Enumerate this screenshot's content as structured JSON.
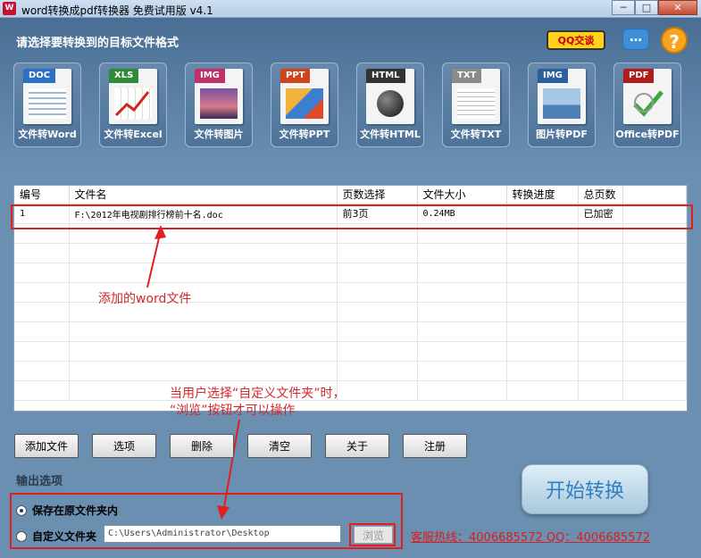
{
  "window": {
    "title": "word转换成pdf转换器 免费试用版 v4.1",
    "controls": [
      "─",
      "□",
      "✕"
    ]
  },
  "header": {
    "prompt": "请选择要转换到的目标文件格式",
    "qq_label": "QQ交谈",
    "chat_glyph": "…",
    "help_glyph": "?"
  },
  "tools": [
    {
      "tag": "DOC",
      "label": "文件转Word",
      "color": "#2d6fc4"
    },
    {
      "tag": "XLS",
      "label": "文件转Excel",
      "color": "#2e8b3a"
    },
    {
      "tag": "IMG",
      "label": "文件转图片",
      "color": "#c0306a"
    },
    {
      "tag": "PPT",
      "label": "文件转PPT",
      "color": "#d0441c"
    },
    {
      "tag": "HTML",
      "label": "文件转HTML",
      "color": "#333333"
    },
    {
      "tag": "TXT",
      "label": "文件转TXT",
      "color": "#8a8a8a"
    },
    {
      "tag": "IMG",
      "label": "图片转PDF",
      "color": "#2b5f9e"
    },
    {
      "tag": "PDF",
      "label": "Office转PDF",
      "color": "#b01c1c"
    }
  ],
  "table": {
    "columns": [
      "编号",
      "文件名",
      "页数选择",
      "文件大小",
      "转换进度",
      "总页数"
    ],
    "rows": [
      [
        "1",
        "F:\\2012年电视剧排行榜前十名.doc",
        "前3页",
        "0.24MB",
        "",
        "已加密"
      ]
    ]
  },
  "annotations": {
    "added_word": "添加的word文件",
    "browse_note_line1": "当用户选择“自定义文件夹”时，",
    "browse_note_line2": "“浏览”按钮才可以操作"
  },
  "buttons": {
    "add": "添加文件",
    "options": "选项",
    "delete": "删除",
    "clear": "清空",
    "about": "关于",
    "register": "注册"
  },
  "output": {
    "section_label": "输出选项",
    "option_original": "保存在原文件夹内",
    "option_custom": "自定义文件夹",
    "path": "C:\\Users\\Administrator\\Desktop",
    "browse": "浏览",
    "selected": "original"
  },
  "start_label": "开始转换",
  "hotline": "客服热线：4006685572 QQ：4006685572",
  "colors": {
    "accent_red": "#e02020",
    "header_blue": "#4a6e93"
  }
}
